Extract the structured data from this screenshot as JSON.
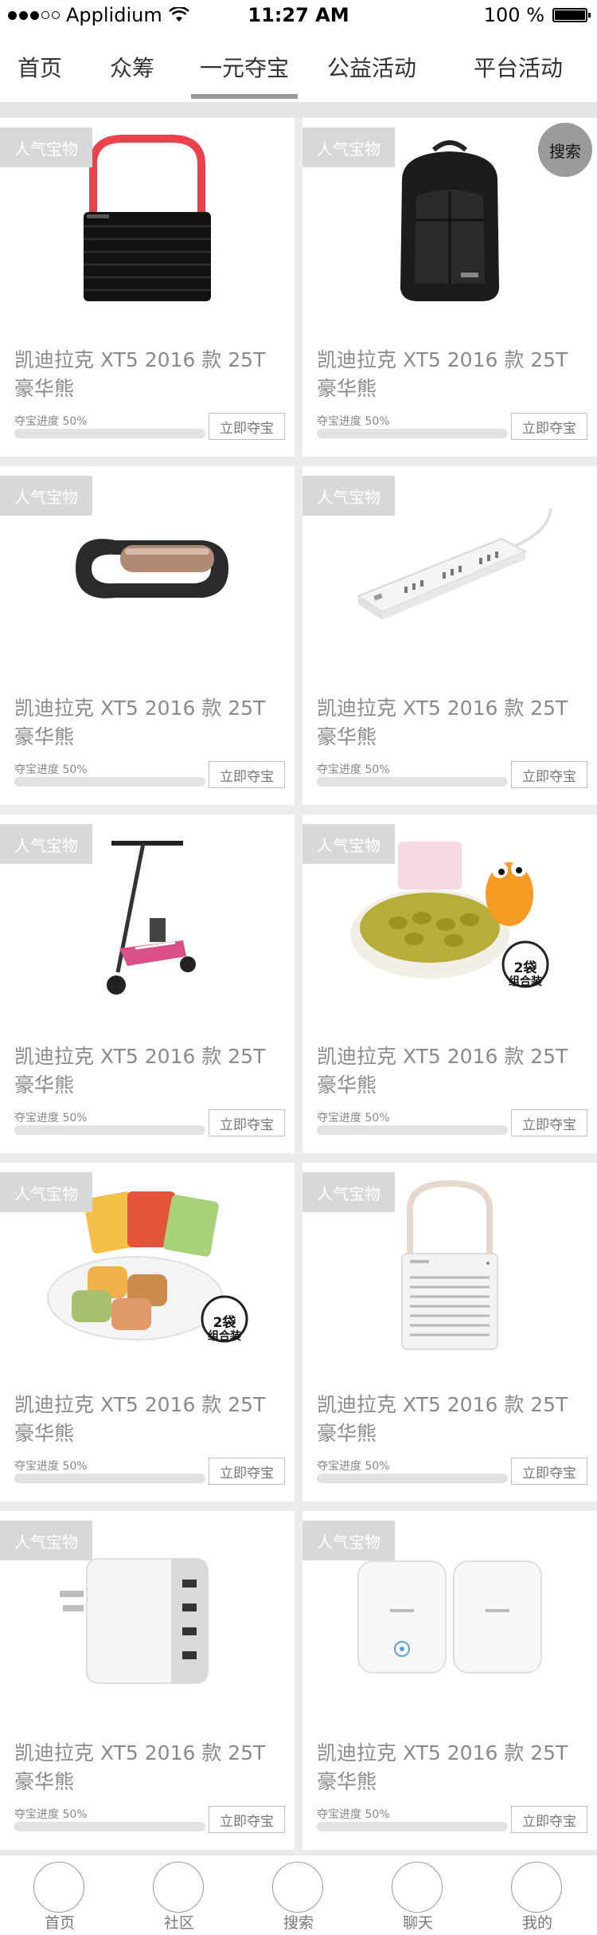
{
  "status_bar": {
    "carrier": "Applidium",
    "time": "11:27 AM",
    "battery": "100 %"
  },
  "nav": {
    "tabs": [
      {
        "label": "首页"
      },
      {
        "label": "众筹"
      },
      {
        "label": "一元夺宝",
        "active": true
      },
      {
        "label": "公益活动"
      },
      {
        "label": "平台活动"
      }
    ]
  },
  "search_button": {
    "label": "搜索"
  },
  "products": [
    {
      "tag": "人气宝物",
      "title": "凯迪拉克 XT5 2016 款 25T豪华熊",
      "progress_label": "夺宝进度 50%",
      "progress": 0.5,
      "button": "立即夺宝",
      "image": "speaker-icon"
    },
    {
      "tag": "人气宝物",
      "title": "凯迪拉克 XT5 2016 款 25T豪华熊",
      "progress_label": "夺宝进度 50%",
      "progress": 0.5,
      "button": "立即夺宝",
      "image": "backpack-icon"
    },
    {
      "tag": "人气宝物",
      "title": "凯迪拉克 XT5 2016 款 25T豪华熊",
      "progress_label": "夺宝进度 50%",
      "progress": 0.5,
      "button": "立即夺宝",
      "image": "fitness-band-icon"
    },
    {
      "tag": "人气宝物",
      "title": "凯迪拉克 XT5 2016 款 25T豪华熊",
      "progress_label": "夺宝进度 50%",
      "progress": 0.5,
      "button": "立即夺宝",
      "image": "power-strip-icon"
    },
    {
      "tag": "人气宝物",
      "title": "凯迪拉克 XT5 2016 款 25T豪华熊",
      "progress_label": "夺宝进度 50%",
      "progress": 0.5,
      "button": "立即夺宝",
      "image": "scooter-icon"
    },
    {
      "tag": "人气宝物",
      "title": "凯迪拉克 XT5 2016 款 25T豪华熊",
      "progress_label": "夺宝进度 50%",
      "progress": 0.5,
      "button": "立即夺宝",
      "image": "raisins-icon",
      "badge": [
        "2袋",
        "组合装"
      ]
    },
    {
      "tag": "人气宝物",
      "title": "凯迪拉克 XT5 2016 款 25T豪华熊",
      "progress_label": "夺宝进度 50%",
      "progress": 0.5,
      "button": "立即夺宝",
      "image": "snack-cakes-icon",
      "badge": [
        "2袋",
        "组合装"
      ]
    },
    {
      "tag": "人气宝物",
      "title": "凯迪拉克 XT5 2016 款 25T豪华熊",
      "progress_label": "夺宝进度 50%",
      "progress": 0.5,
      "button": "立即夺宝",
      "image": "white-speaker-icon"
    },
    {
      "tag": "人气宝物",
      "title": "凯迪拉克 XT5 2016 款 25T豪华熊",
      "progress_label": "夺宝进度 50%",
      "progress": 0.5,
      "button": "立即夺宝",
      "image": "usb-charger-icon"
    },
    {
      "tag": "人气宝物",
      "title": "凯迪拉克 XT5 2016 款 25T豪华熊",
      "progress_label": "夺宝进度 50%",
      "progress": 0.5,
      "button": "立即夺宝",
      "image": "router-icon"
    }
  ],
  "bottom_bar": {
    "items": [
      {
        "label": "首页"
      },
      {
        "label": "社区"
      },
      {
        "label": "搜索"
      },
      {
        "label": "聊天"
      },
      {
        "label": "我的"
      }
    ]
  },
  "colors": {
    "background": "#ececec",
    "tag_background": "#d8d8d8",
    "active_underline": "#999999",
    "search_fab": "#9a9a9a"
  }
}
